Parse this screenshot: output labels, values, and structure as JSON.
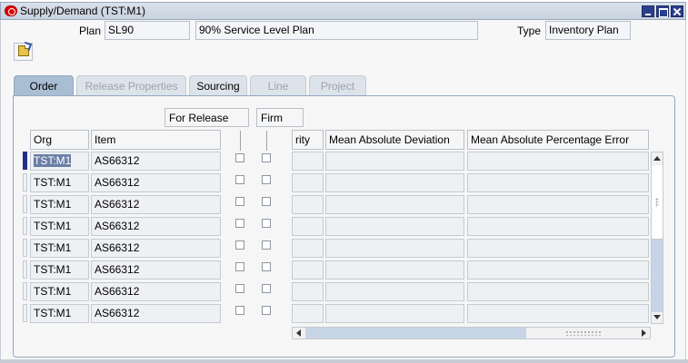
{
  "window": {
    "title": "Supply/Demand (TST:M1)"
  },
  "header": {
    "plan_label": "Plan",
    "plan_code": "SL90",
    "plan_description": "90% Service Level Plan",
    "type_label": "Type",
    "type_value": "Inventory Plan"
  },
  "tabs": [
    {
      "label": "Order",
      "state": "active"
    },
    {
      "label": "Release Properties",
      "state": "disabled"
    },
    {
      "label": "Sourcing",
      "state": "enabled"
    },
    {
      "label": "Line",
      "state": "disabled"
    },
    {
      "label": "Project",
      "state": "disabled"
    }
  ],
  "grid": {
    "group_for_release": "For Release",
    "group_firm": "Firm",
    "col_org": "Org",
    "col_item": "Item",
    "col_priority_partial": "rity",
    "col_mad": "Mean Absolute Deviation",
    "col_mape": "Mean Absolute Percentage Error",
    "rows": [
      {
        "org": "TST:M1",
        "item": "AS66312"
      },
      {
        "org": "TST:M1",
        "item": "AS66312"
      },
      {
        "org": "TST:M1",
        "item": "AS66312"
      },
      {
        "org": "TST:M1",
        "item": "AS66312"
      },
      {
        "org": "TST:M1",
        "item": "AS66312"
      },
      {
        "org": "TST:M1",
        "item": "AS66312"
      },
      {
        "org": "TST:M1",
        "item": "AS66312"
      },
      {
        "org": "TST:M1",
        "item": "AS66312"
      }
    ]
  },
  "icons": {
    "app": "oracle-logo-icon",
    "toolbar": "open-folder-icon"
  }
}
